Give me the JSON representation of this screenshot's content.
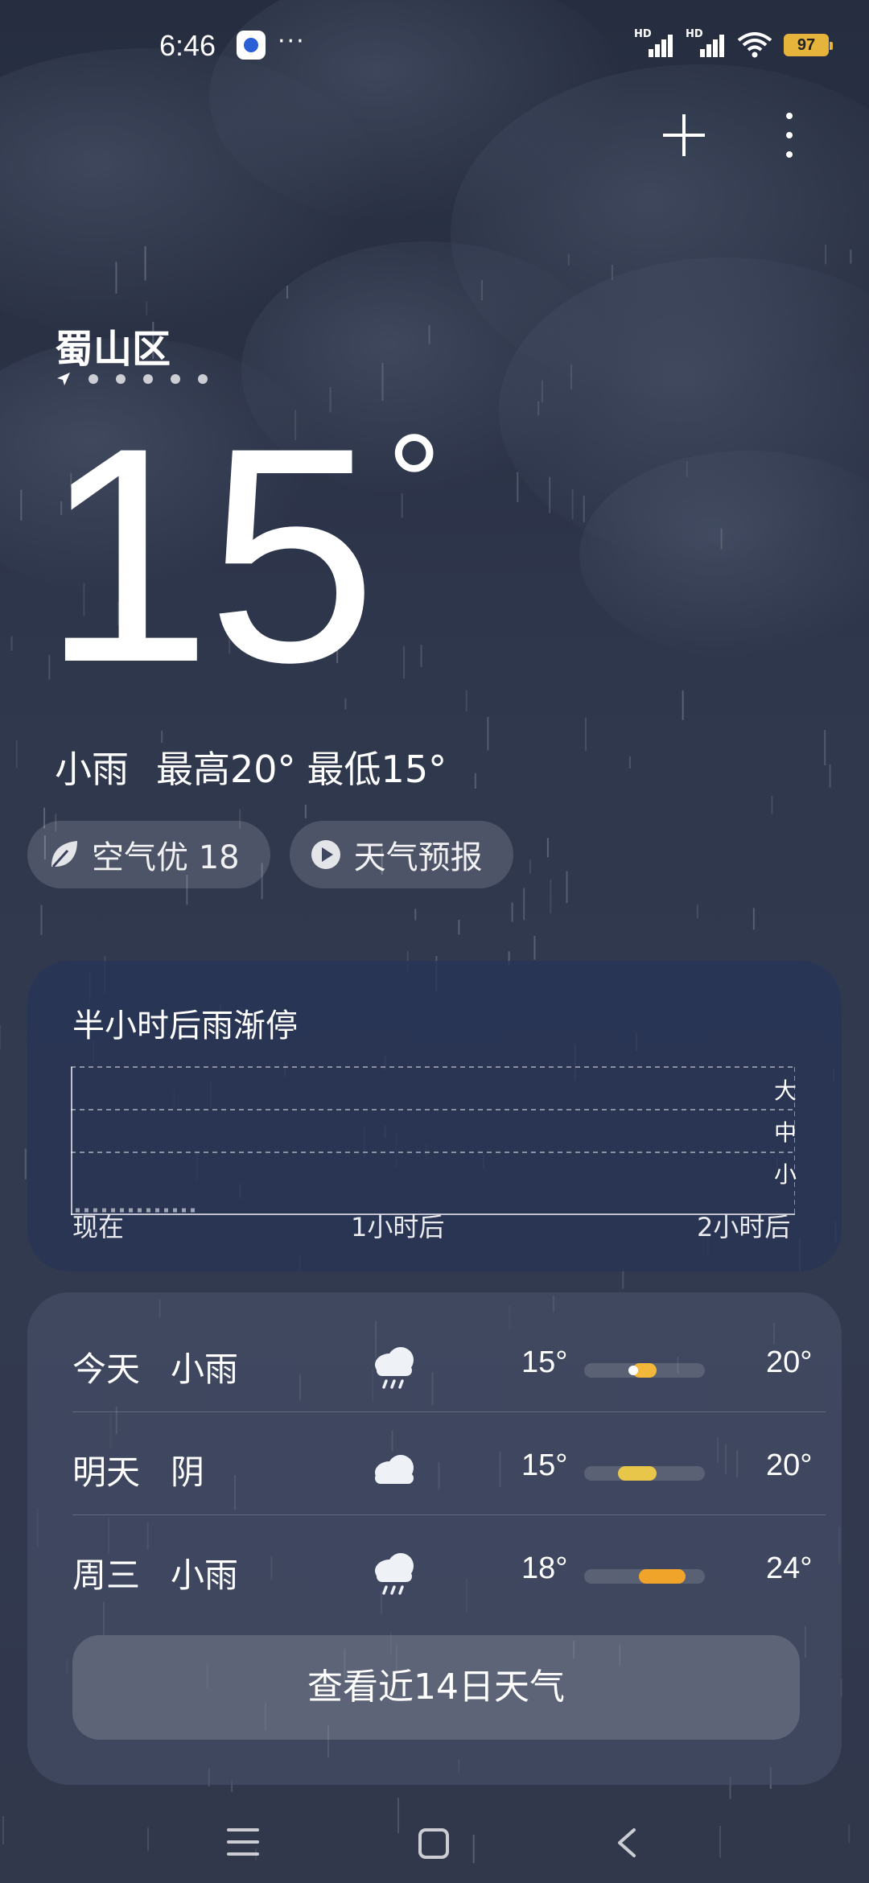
{
  "status_bar": {
    "time": "6:46",
    "dots": "···",
    "signal_label_1": "HD",
    "signal_label_2": "HD",
    "battery": "97",
    "battery_color": "#e6b43a"
  },
  "header": {
    "location": "蜀山区"
  },
  "current": {
    "temperature": "15",
    "degree": "°",
    "condition": "小雨",
    "high": "最高20°",
    "low": "最低15°"
  },
  "chips": {
    "air_quality": "空气优 18",
    "forecast_video": "天气预报"
  },
  "rain_card": {
    "title": "半小时后雨渐停",
    "levels": [
      "大",
      "中",
      "小"
    ],
    "time_labels": [
      "现在",
      "1小时后",
      "2小时后"
    ]
  },
  "forecast": {
    "rows": [
      {
        "day": "今天",
        "condition": "小雨",
        "icon": "rain-cloud-icon",
        "low": "15°",
        "high": "20°",
        "bar_start": 0.4,
        "bar_end": 0.6,
        "current_pos": 0.38,
        "bar_color": "#f1b83a"
      },
      {
        "day": "明天",
        "condition": "阴",
        "icon": "cloud-icon",
        "low": "15°",
        "high": "20°",
        "bar_start": 0.28,
        "bar_end": 0.6,
        "bar_color": "#e7c64a"
      },
      {
        "day": "周三",
        "condition": "小雨",
        "icon": "rain-cloud-icon",
        "low": "18°",
        "high": "24°",
        "bar_start": 0.45,
        "bar_end": 0.84,
        "bar_color": "#f0a42a"
      }
    ],
    "button_label": "查看近14日天气"
  }
}
